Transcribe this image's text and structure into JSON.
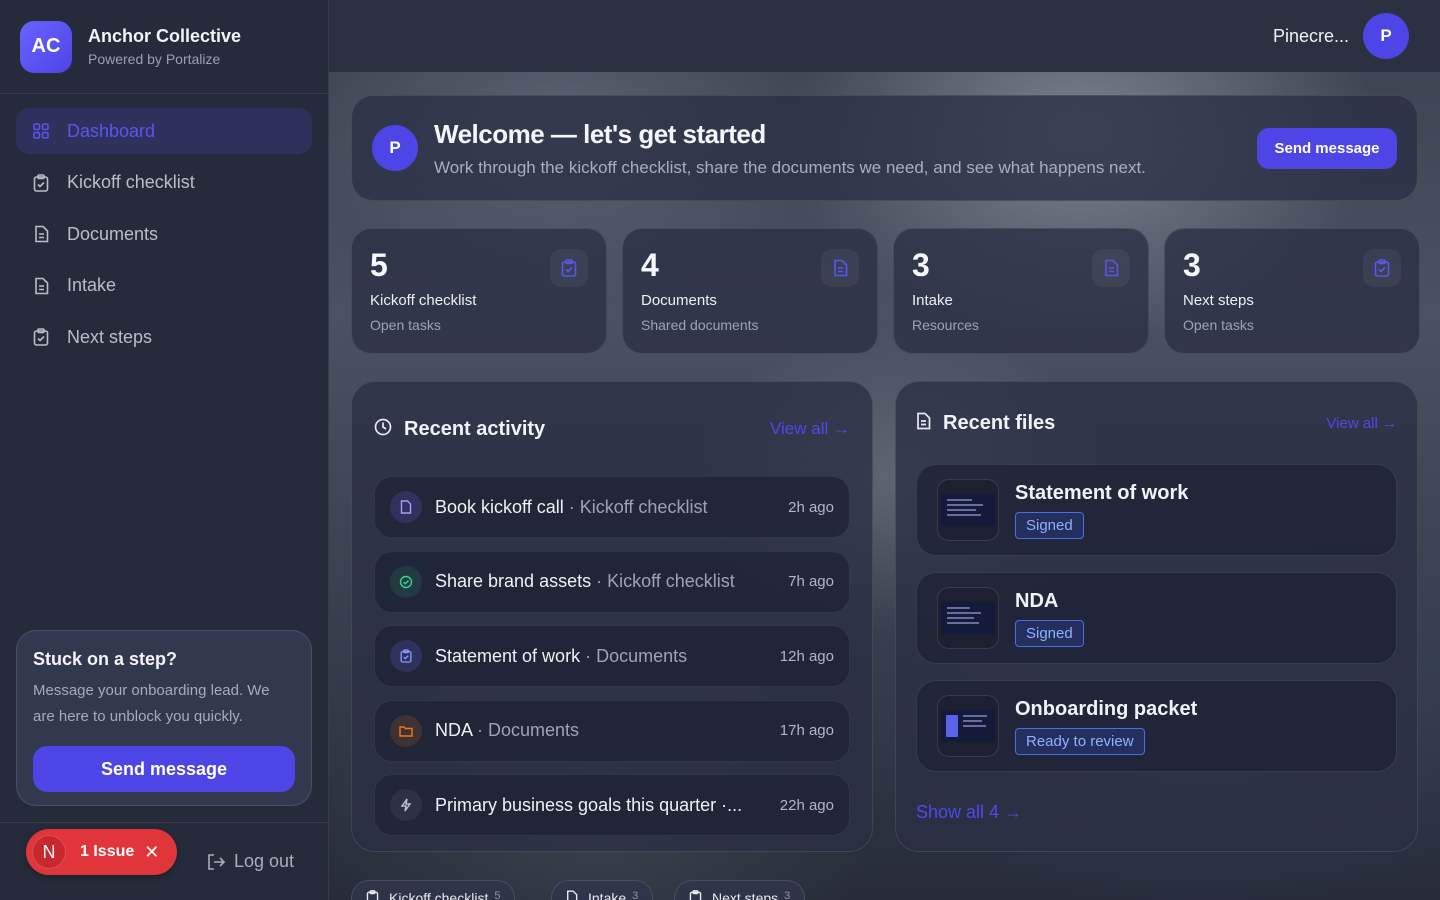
{
  "brand": {
    "logo": "AC",
    "name": "Anchor Collective",
    "subtitle": "Powered by Portalize"
  },
  "nav": [
    {
      "label": "Dashboard",
      "icon": "grid-icon",
      "active": true
    },
    {
      "label": "Kickoff checklist",
      "icon": "clipboard-icon"
    },
    {
      "label": "Documents",
      "icon": "document-icon"
    },
    {
      "label": "Intake",
      "icon": "document-icon"
    },
    {
      "label": "Next steps",
      "icon": "clipboard-icon"
    }
  ],
  "help": {
    "title": "Stuck on a step?",
    "body": "Message your onboarding lead. We are here to unblock you quickly.",
    "button": "Send message"
  },
  "footer": {
    "issue_avatar": "N",
    "issue_label": "1 Issue",
    "logout": "Log out"
  },
  "user": {
    "name": "Pinecre...",
    "initial": "P"
  },
  "welcome": {
    "initial": "P",
    "title": "Welcome — let's get started",
    "subtitle": "Work through the kickoff checklist, share the documents we need, and see what happens next.",
    "button": "Send message"
  },
  "stats": [
    {
      "value": "5",
      "label": "Kickoff checklist",
      "sub": "Open tasks"
    },
    {
      "value": "4",
      "label": "Documents",
      "sub": "Shared documents"
    },
    {
      "value": "3",
      "label": "Intake",
      "sub": "Resources"
    },
    {
      "value": "3",
      "label": "Next steps",
      "sub": "Open tasks"
    }
  ],
  "activity": {
    "title": "Recent activity",
    "view_all": "View all →",
    "items": [
      {
        "name": "Book kickoff call",
        "category": " · Kickoff checklist",
        "time": "2h ago",
        "icon": "file-icon",
        "color": "#8b7cf6"
      },
      {
        "name": "Share brand assets",
        "category": " · Kickoff checklist",
        "time": "7h ago",
        "icon": "check-circle-icon",
        "color": "#34d399"
      },
      {
        "name": "Statement of work",
        "category": " · Documents",
        "time": "12h ago",
        "icon": "clipboard-icon",
        "color": "#818cf8"
      },
      {
        "name": "NDA",
        "category": " · Documents",
        "time": "17h ago",
        "icon": "folder-icon",
        "color": "#f97316"
      },
      {
        "name": "Primary business goals this quarter ·...",
        "category": "",
        "time": "22h ago",
        "icon": "bolt-icon",
        "color": "#c0c4d2"
      }
    ]
  },
  "files": {
    "title": "Recent files",
    "view_all": "View all →",
    "items": [
      {
        "name": "Statement of work",
        "status": "Signed"
      },
      {
        "name": "NDA",
        "status": "Signed"
      },
      {
        "name": "Onboarding packet",
        "status": "Ready to review"
      }
    ],
    "show_all": "Show all 4 →"
  },
  "bottom_tabs": [
    {
      "label": "Kickoff checklist",
      "count": "5"
    },
    {
      "label": "Intake",
      "count": "3"
    },
    {
      "label": "Next steps",
      "count": "3"
    }
  ],
  "colors": {
    "accent": "#4d45e5",
    "danger": "#e0353a"
  }
}
